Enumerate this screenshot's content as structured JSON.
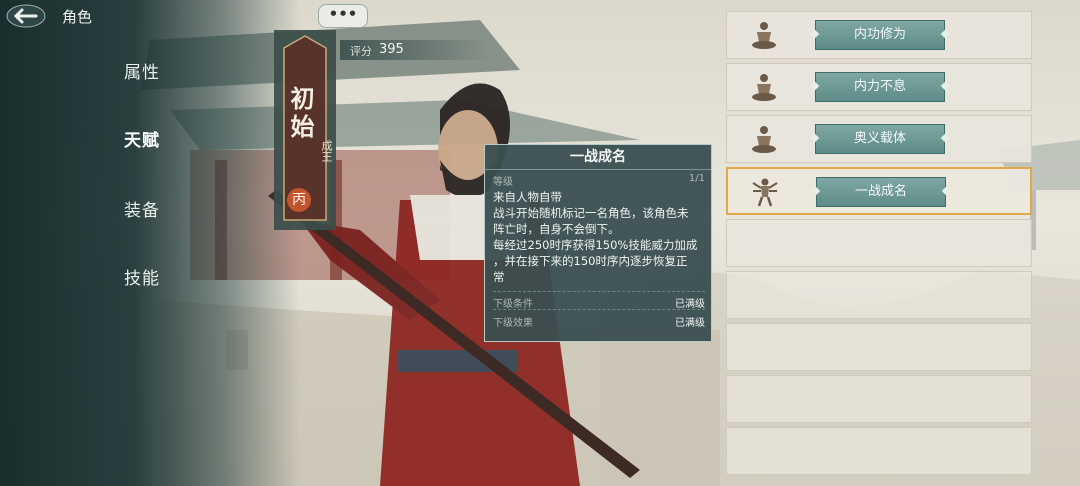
{
  "header": {
    "title": "角色"
  },
  "sidebar": {
    "items": [
      {
        "label": "属性"
      },
      {
        "label": "天赋"
      },
      {
        "label": "装备"
      },
      {
        "label": "技能"
      }
    ]
  },
  "character": {
    "name": "初始",
    "title": "成王",
    "grade": "丙",
    "score_label": "评分",
    "score": "395",
    "chat": "•••"
  },
  "tooltip": {
    "title": "一战成名",
    "level_label": "等级",
    "level_value": "1/1",
    "lines": [
      "来自人物自带",
      "战斗开始随机标记一名角色，该角色未",
      "阵亡时，自身不会倒下。",
      "每经过250时序获得150%技能威力加成",
      "，并在接下来的150时序内逐步恢复正",
      "常"
    ],
    "next_condition_label": "下级条件",
    "next_condition_value": "已满级",
    "next_effect_label": "下级效果",
    "next_effect_value": "已满级"
  },
  "talents": [
    {
      "name": "内功修为",
      "icon": "meditating-monk-icon"
    },
    {
      "name": "内力不息",
      "icon": "meditating-monk-icon"
    },
    {
      "name": "奥义载体",
      "icon": "meditating-monk-icon"
    },
    {
      "name": "一战成名",
      "icon": "multi-armed-warrior-icon",
      "selected": true
    }
  ],
  "empty_slots": 5,
  "colors": {
    "sidebar": "#1c3434",
    "button": "#5e8c88",
    "selected_border": "#e0a84a",
    "grade_badge": "#c0552f"
  }
}
